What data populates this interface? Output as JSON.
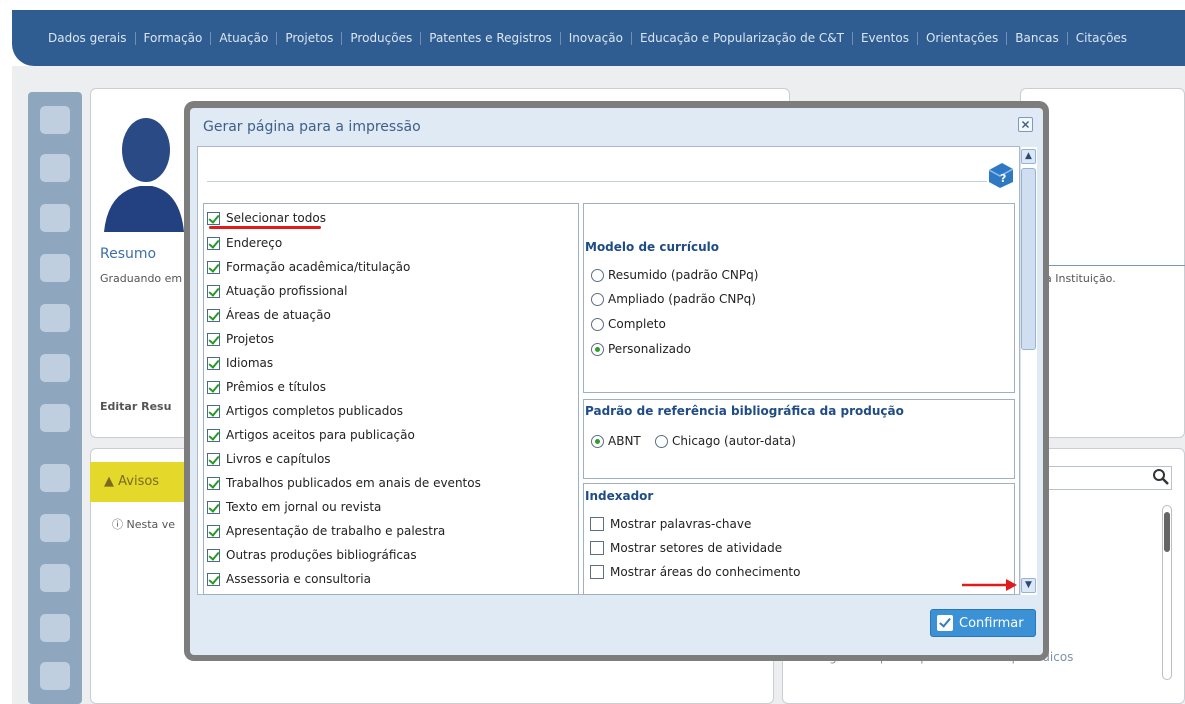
{
  "nav": [
    "Dados gerais",
    "Formação",
    "Atuação",
    "Projetos",
    "Produções",
    "Patentes e Registros",
    "Inovação",
    "Educação e Popularização de C&T",
    "Eventos",
    "Orientações",
    "Bancas",
    "Citações"
  ],
  "background": {
    "resumo_title": "Resumo",
    "resumo_text": "Graduando em H",
    "resumo_right_text": "r da Instituição.",
    "editar_label": "Editar Resu",
    "avisos_label": "Avisos",
    "nesta_text": "Nesta ve",
    "artigos_text": "Artigos completos publicados em periódicos"
  },
  "modal": {
    "title": "Gerar página para a impressão",
    "checkbox_items": [
      {
        "label": "Selecionar todos",
        "checked": true
      },
      {
        "label": "Endereço",
        "checked": true
      },
      {
        "label": "Formação acadêmica/titulação",
        "checked": true
      },
      {
        "label": "Atuação profissional",
        "checked": true
      },
      {
        "label": "Áreas de atuação",
        "checked": true
      },
      {
        "label": "Projetos",
        "checked": true
      },
      {
        "label": "Idiomas",
        "checked": true
      },
      {
        "label": "Prêmios e títulos",
        "checked": true
      },
      {
        "label": "Artigos completos publicados",
        "checked": true
      },
      {
        "label": "Artigos aceitos para publicação",
        "checked": true
      },
      {
        "label": "Livros e capítulos",
        "checked": true
      },
      {
        "label": "Trabalhos publicados em anais de eventos",
        "checked": true
      },
      {
        "label": "Texto em jornal ou revista",
        "checked": true
      },
      {
        "label": "Apresentação de trabalho e palestra",
        "checked": true
      },
      {
        "label": "Outras produções bibliográficas",
        "checked": true
      },
      {
        "label": "Assessoria e consultoria",
        "checked": true
      }
    ],
    "modelo": {
      "title": "Modelo de currículo",
      "options": [
        "Resumido (padrão CNPq)",
        "Ampliado (padrão CNPq)",
        "Completo",
        "Personalizado"
      ],
      "selected": "Personalizado"
    },
    "padrao": {
      "title": "Padrão de referência bibliográfica da produção",
      "options": [
        "ABNT",
        "Chicago (autor-data)"
      ],
      "selected": "ABNT"
    },
    "indexador": {
      "title": "Indexador",
      "options": [
        "Mostrar palavras-chave",
        "Mostrar setores de atividade",
        "Mostrar áreas do conhecimento"
      ]
    },
    "confirm_label": "Confirmar"
  },
  "colors": {
    "nav_bg": "#2f5d91",
    "confirm_bg": "#3b91d6",
    "check_green": "#239a23",
    "annotation_red": "#e01b1b"
  }
}
